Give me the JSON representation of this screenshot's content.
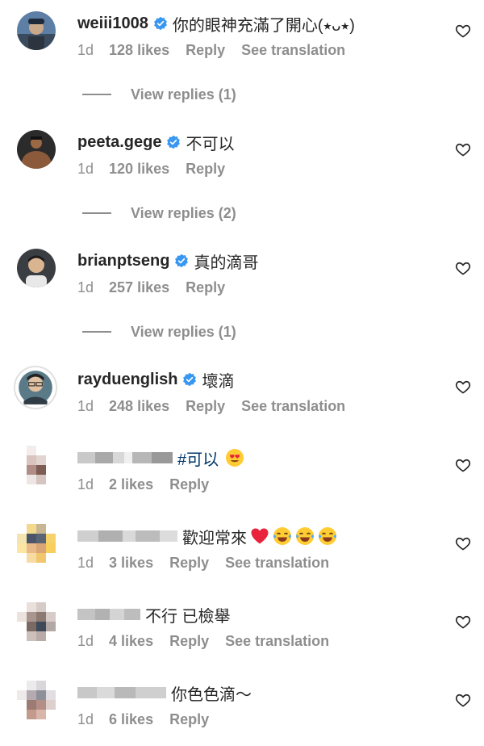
{
  "comments": [
    {
      "username": "weiii1008",
      "verified": true,
      "text": "你的眼神充滿了開心(⭑ᴗ⭑)",
      "time": "1d",
      "likes": "128 likes",
      "reply": "Reply",
      "translate": "See translation",
      "view_replies": "View replies (1)"
    },
    {
      "username": "peeta.gege",
      "verified": true,
      "text": "不可以",
      "time": "1d",
      "likes": "120 likes",
      "reply": "Reply",
      "view_replies": "View replies (2)"
    },
    {
      "username": "brianptseng",
      "verified": true,
      "text": "真的滴哥",
      "time": "1d",
      "likes": "257 likes",
      "reply": "Reply",
      "view_replies": "View replies (1)"
    },
    {
      "username": "rayduenglish",
      "verified": true,
      "text": "壞滴",
      "time": "1d",
      "likes": "248 likes",
      "reply": "Reply",
      "translate": "See translation"
    },
    {
      "username": "",
      "hashtag": "#可以",
      "text": "",
      "emoji": [
        "heart-eyes"
      ],
      "time": "1d",
      "likes": "2 likes",
      "reply": "Reply"
    },
    {
      "username": "",
      "text": "歡迎常來",
      "emoji": [
        "red-heart",
        "joy",
        "joy",
        "joy"
      ],
      "time": "1d",
      "likes": "3 likes",
      "reply": "Reply",
      "translate": "See translation"
    },
    {
      "username": "",
      "text": "不行 已檢舉",
      "time": "1d",
      "likes": "4 likes",
      "reply": "Reply",
      "translate": "See translation"
    },
    {
      "username": "",
      "text": "你色色滴～",
      "time": "1d",
      "likes": "6 likes",
      "reply": "Reply"
    }
  ],
  "colors": {
    "text": "#262626",
    "muted": "#8e8e8e",
    "verified": "#3897f0",
    "hashtag": "#00376b"
  },
  "icons": {
    "verified": "verified-badge-icon",
    "like": "heart-outline-icon"
  }
}
